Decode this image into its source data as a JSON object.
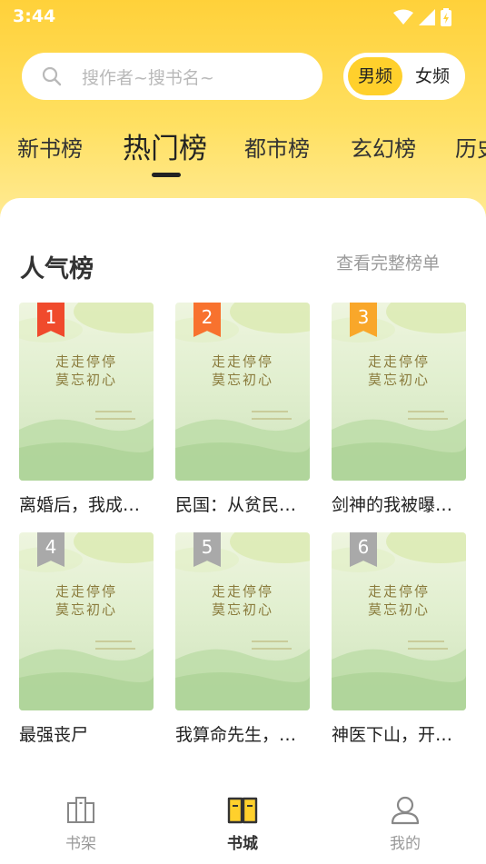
{
  "status": {
    "time": "3:44"
  },
  "search": {
    "placeholder": "搜作者~搜书名~"
  },
  "gender": {
    "male": "男频",
    "female": "女频",
    "active": "male"
  },
  "tabs": [
    {
      "label": "新书榜"
    },
    {
      "label": "热门榜"
    },
    {
      "label": "都市榜"
    },
    {
      "label": "玄幻榜"
    },
    {
      "label": "历史"
    }
  ],
  "active_tab": 1,
  "section": {
    "title": "人气榜",
    "more": "查看完整榜单"
  },
  "cover_text": {
    "line1": "走走停停",
    "line2": "莫忘初心"
  },
  "books": [
    {
      "rank": "1",
      "title": "离婚后，我成…",
      "badge_color": "#f04a2c"
    },
    {
      "rank": "2",
      "title": "民国：从贫民…",
      "badge_color": "#f8722e"
    },
    {
      "rank": "3",
      "title": "剑神的我被曝…",
      "badge_color": "#f9a72a"
    },
    {
      "rank": "4",
      "title": "最强丧尸",
      "badge_color": "#a9a9a9"
    },
    {
      "rank": "5",
      "title": "我算命先生，…",
      "badge_color": "#a9a9a9"
    },
    {
      "rank": "6",
      "title": "神医下山，开…",
      "badge_color": "#a9a9a9"
    }
  ],
  "nav": [
    {
      "label": "书架",
      "icon": "bookshelf-icon"
    },
    {
      "label": "书城",
      "icon": "book-open-icon",
      "active": true
    },
    {
      "label": "我的",
      "icon": "user-icon"
    }
  ],
  "colors": {
    "accent": "#ffd02c",
    "header_top": "#ffd13a"
  }
}
